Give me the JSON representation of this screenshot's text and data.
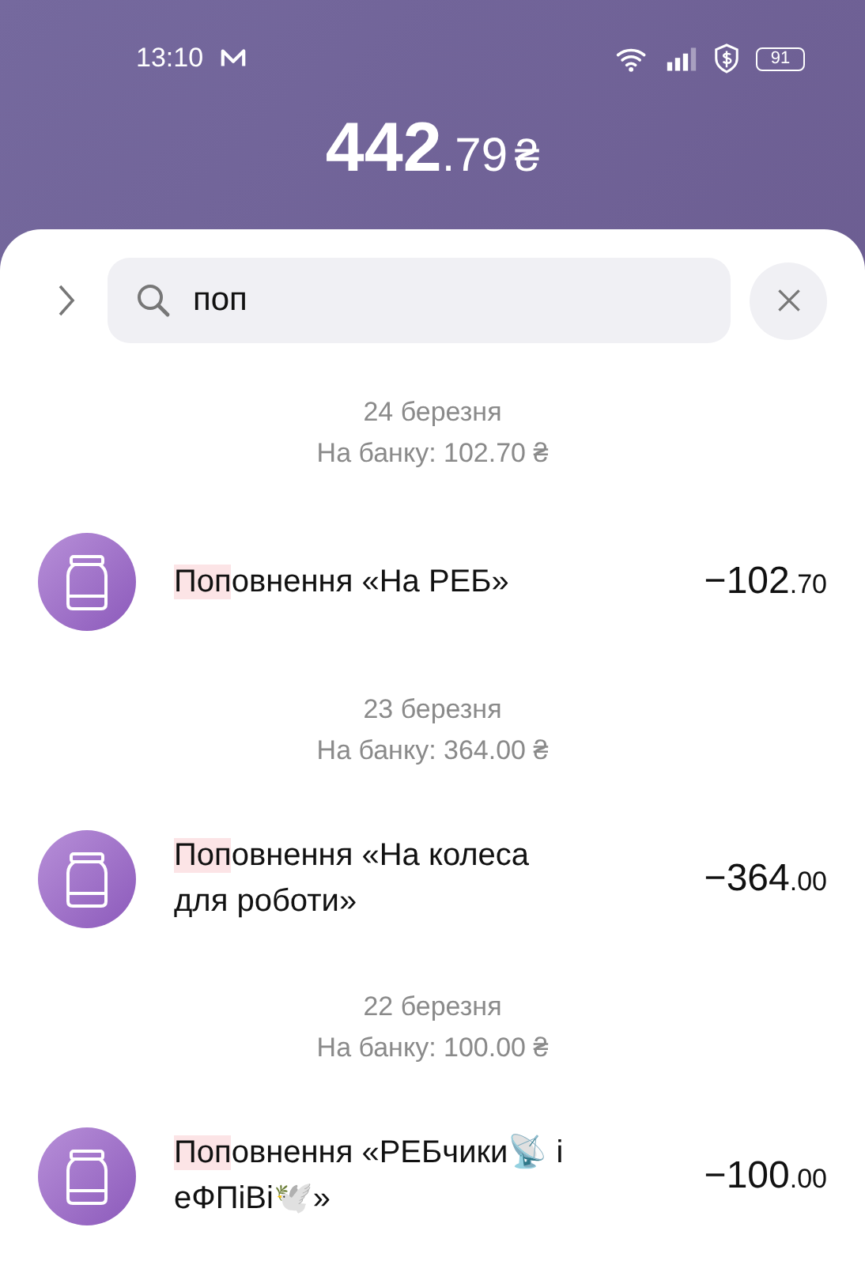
{
  "status_bar": {
    "time": "13:10",
    "battery": "91"
  },
  "balance": {
    "whole": "442",
    "fraction": ".79",
    "currency": "₴"
  },
  "search": {
    "value": "поп"
  },
  "groups": [
    {
      "date": "24 березня",
      "bank_total": "На банку: 102.70 ₴",
      "transactions": [
        {
          "match": "Поп",
          "rest": "овнення «На РЕБ»",
          "amount": "−102",
          "cents": ".70"
        }
      ]
    },
    {
      "date": "23 березня",
      "bank_total": "На банку: 364.00 ₴",
      "transactions": [
        {
          "match": "Поп",
          "rest": "овнення «На колеса для роботи»",
          "amount": "−364",
          "cents": ".00"
        }
      ]
    },
    {
      "date": "22 березня",
      "bank_total": "На банку: 100.00 ₴",
      "transactions": [
        {
          "match": "Поп",
          "rest": "овнення «РЕБчики📡 і еФПіВі🕊️»",
          "amount": "−100",
          "cents": ".00"
        }
      ]
    }
  ]
}
